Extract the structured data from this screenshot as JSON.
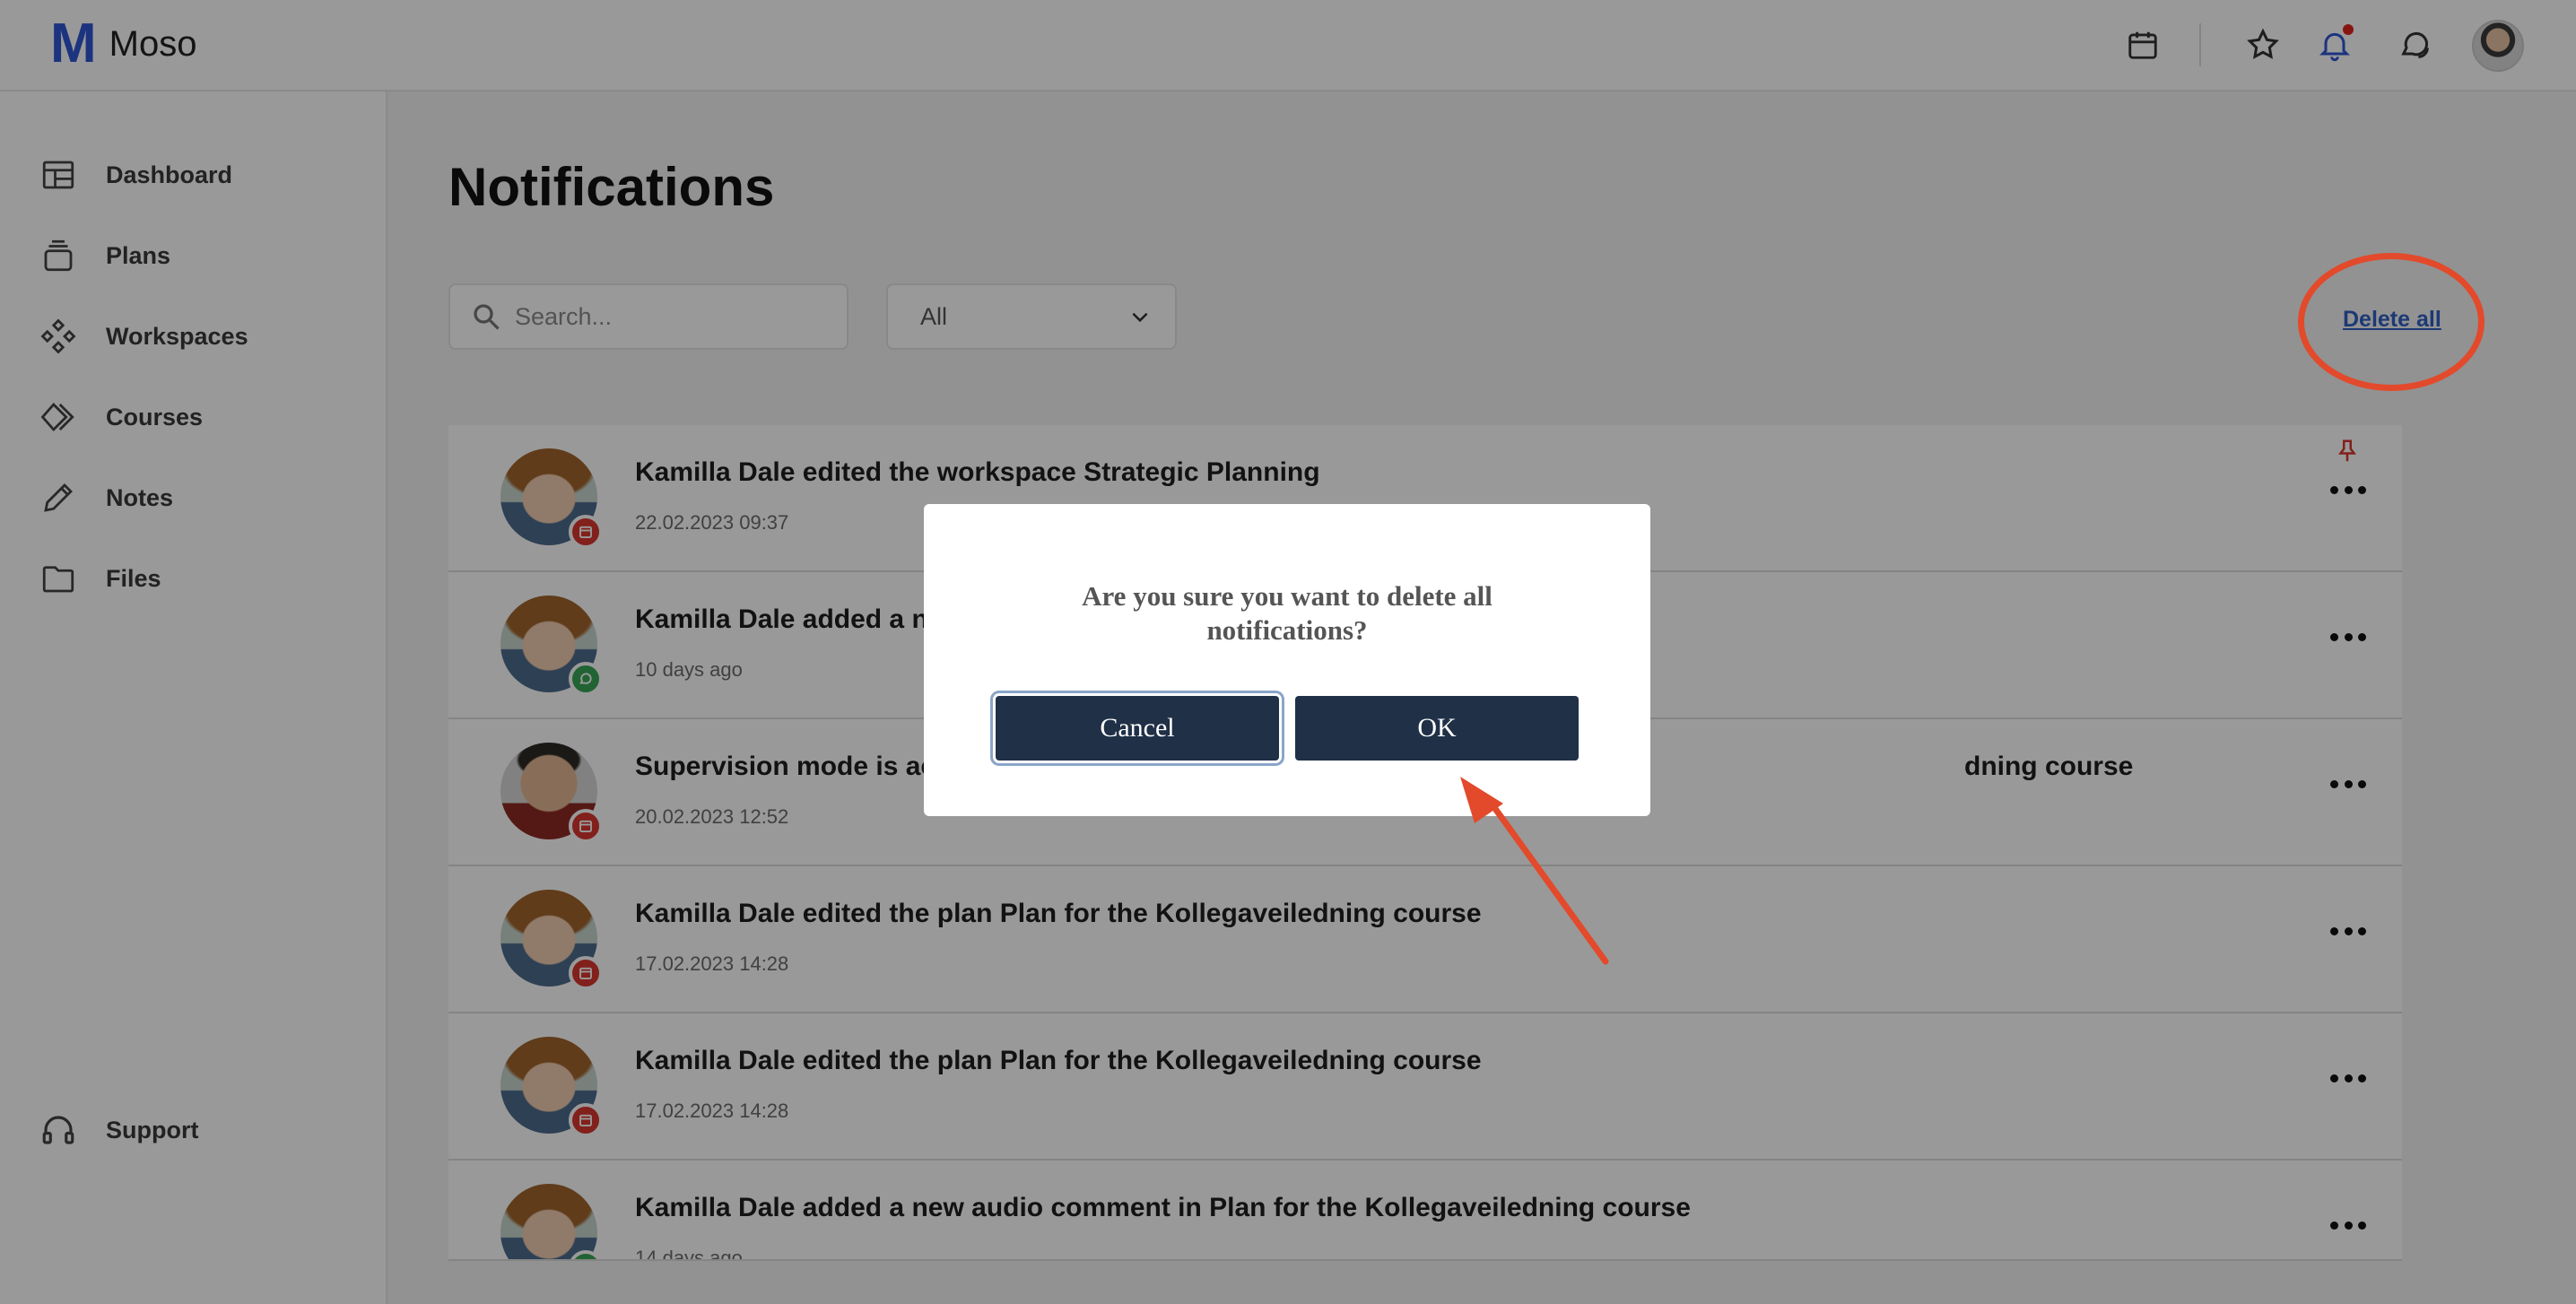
{
  "app": {
    "logo_mark": "M",
    "name": "Moso"
  },
  "header": {
    "icons": [
      "calendar-icon",
      "star-icon",
      "bell-icon",
      "chat-icon",
      "user-avatar"
    ],
    "accent": "#2f55d4"
  },
  "sidebar": {
    "items": [
      {
        "label": "Dashboard",
        "icon": "dashboard-icon"
      },
      {
        "label": "Plans",
        "icon": "plans-icon"
      },
      {
        "label": "Workspaces",
        "icon": "workspaces-icon"
      },
      {
        "label": "Courses",
        "icon": "courses-icon"
      },
      {
        "label": "Notes",
        "icon": "pencil-icon"
      },
      {
        "label": "Files",
        "icon": "folder-icon"
      }
    ],
    "support_label": "Support"
  },
  "main": {
    "title": "Notifications",
    "search_placeholder": "Search...",
    "filter_value": "All",
    "delete_all_label": "Delete all",
    "notifications": [
      {
        "title": "Kamilla Dale edited the workspace Strategic Planning",
        "date": "22.02.2023 09:37",
        "avatar": "woman",
        "badge": "red",
        "pinned": true
      },
      {
        "title": "Kamilla Dale added a ne",
        "date": "10 days ago",
        "avatar": "woman",
        "badge": "green",
        "pinned": false
      },
      {
        "title": "Supervision mode is ac",
        "title_tail": "dning course",
        "date": "20.02.2023 12:52",
        "avatar": "man",
        "badge": "red",
        "pinned": false
      },
      {
        "title": "Kamilla Dale edited the plan Plan for the Kollegaveiledning course",
        "date": "17.02.2023 14:28",
        "avatar": "woman",
        "badge": "red",
        "pinned": false
      },
      {
        "title": "Kamilla Dale edited the plan Plan for the Kollegaveiledning course",
        "date": "17.02.2023 14:28",
        "avatar": "woman",
        "badge": "red",
        "pinned": false
      },
      {
        "title": "Kamilla Dale added a new audio comment in Plan for the Kollegaveiledning course",
        "date": "14 days ago",
        "avatar": "woman",
        "badge": "green",
        "pinned": false
      }
    ]
  },
  "modal": {
    "message": "Are you sure you want to delete all notifications?",
    "cancel_label": "Cancel",
    "ok_label": "OK"
  },
  "colors": {
    "annotation": "#e24a2b",
    "button": "#1f3047",
    "badge_red": "#d9362e",
    "badge_green": "#3aa655"
  }
}
